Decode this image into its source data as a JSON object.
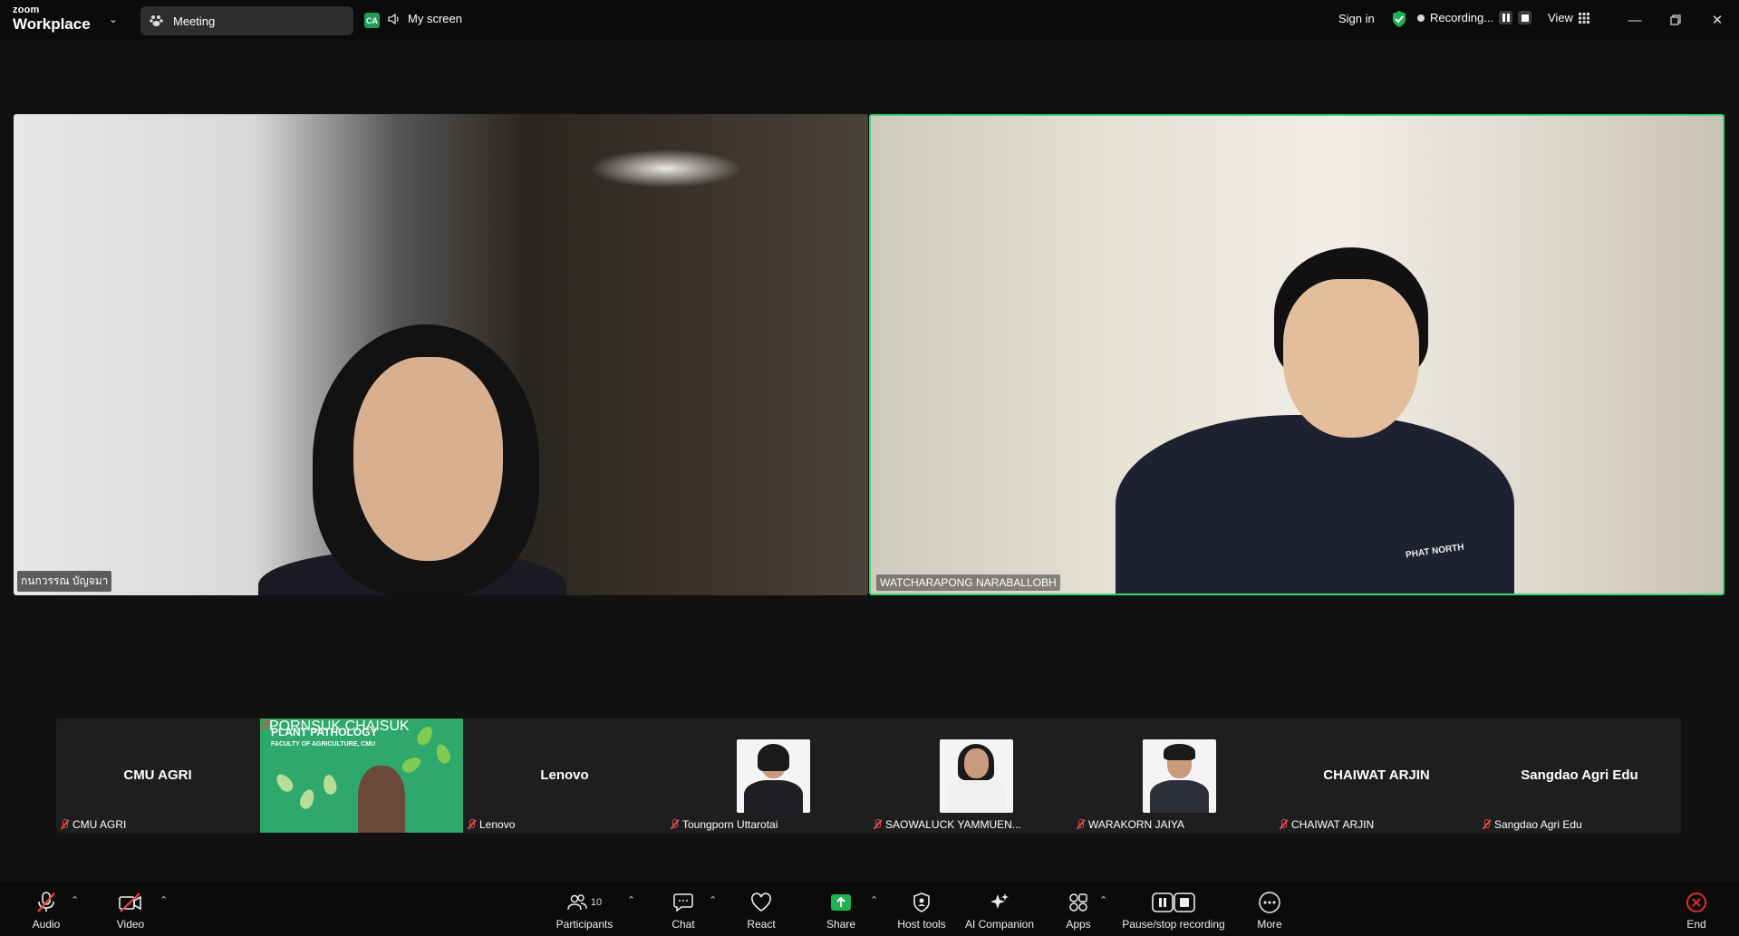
{
  "titlebar": {
    "brand_small": "zoom",
    "brand_large": "Workplace",
    "meeting_label": "Meeting",
    "ca_badge": "CA",
    "my_screen": "My screen",
    "sign_in": "Sign in",
    "recording": "Recording...",
    "view": "View"
  },
  "main": {
    "left_tile_name": "กนกวรรณ บัญจมา",
    "right_tile_name": "WATCHARAPONG NARABALLOBH",
    "right_tile_shirt_text": "PHAT NORTH",
    "active_speaker_color": "#3bd67a"
  },
  "thumbnails": [
    {
      "center": "CMU AGRI",
      "name": "CMU AGRI"
    },
    {
      "center": "",
      "name": "PORNSUK CHAISUK",
      "banner_title": "PLANT PATHOLOGY",
      "banner_sub": "FACULTY OF AGRICULTURE, CMU"
    },
    {
      "center": "Lenovo",
      "name": "Lenovo"
    },
    {
      "center": "",
      "name": "Toungporn Uttarotai"
    },
    {
      "center": "",
      "name": "SAOWALUCK YAMMUEN..."
    },
    {
      "center": "",
      "name": "WARAKORN JAIYA"
    },
    {
      "center": "CHAIWAT ARJIN",
      "name": "CHAIWAT ARJIN"
    },
    {
      "center": "Sangdao Agri Edu",
      "name": "Sangdao Agri Edu"
    }
  ],
  "toolbar": {
    "audio": "Audio",
    "video": "Video",
    "participants": "Participants",
    "participants_count": "10",
    "chat": "Chat",
    "react": "React",
    "share": "Share",
    "host_tools": "Host tools",
    "ai_companion": "AI Companion",
    "apps": "Apps",
    "pause_stop": "Pause/stop recording",
    "more": "More",
    "end": "End"
  }
}
